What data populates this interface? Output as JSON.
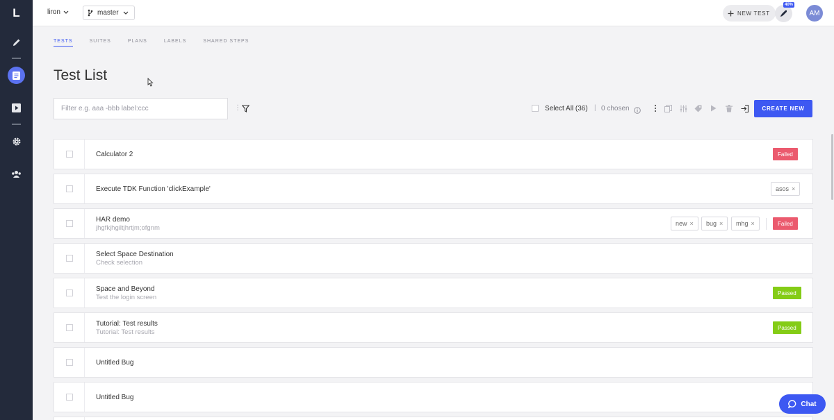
{
  "sidebar": {
    "logo": "L",
    "items": [
      {
        "name": "edit",
        "icon": "pencil-icon"
      },
      {
        "name": "tests",
        "icon": "list-icon",
        "active": true
      },
      {
        "name": "runs",
        "icon": "play-icon"
      },
      {
        "name": "settings",
        "icon": "gear-icon"
      },
      {
        "name": "team",
        "icon": "users-icon"
      }
    ]
  },
  "topbar": {
    "user": "liron",
    "branch": "master",
    "new_test": "NEW TEST",
    "notification_badge": "40%",
    "avatar": "AM"
  },
  "tabs": [
    {
      "label": "TESTS",
      "active": true
    },
    {
      "label": "SUITES",
      "active": false
    },
    {
      "label": "PLANS",
      "active": false
    },
    {
      "label": "LABELS",
      "active": false
    },
    {
      "label": "SHARED STEPS",
      "active": false
    }
  ],
  "page": {
    "title": "Test List"
  },
  "filter": {
    "placeholder": "Filter e.g. aaa -bbb label:ccc",
    "value": ""
  },
  "toolbar": {
    "select_all": "Select All (36)",
    "separator": "|",
    "chosen": "0 chosen",
    "create_new": "CREATE NEW"
  },
  "tests": [
    {
      "title": "Calculator 2",
      "subtitle": "",
      "labels": [],
      "status": "Failed"
    },
    {
      "title": "Execute TDK Function 'clickExample'",
      "subtitle": "",
      "labels": [
        "asos"
      ],
      "status": ""
    },
    {
      "title": "HAR demo",
      "subtitle": "jhgfkjhgiltjhrtjm;ofgnm",
      "labels": [
        "new",
        "bug",
        "mhg"
      ],
      "status": "Failed"
    },
    {
      "title": "Select Space Destination",
      "subtitle": "Check selection",
      "labels": [],
      "status": ""
    },
    {
      "title": "Space and Beyond",
      "subtitle": "Test the login screen",
      "labels": [],
      "status": "Passed"
    },
    {
      "title": "Tutorial: Test results",
      "subtitle": "Tutorial: Test results",
      "labels": [],
      "status": "Passed"
    },
    {
      "title": "Untitled Bug",
      "subtitle": "",
      "labels": [],
      "status": ""
    },
    {
      "title": "Untitled Bug",
      "subtitle": "",
      "labels": [],
      "status": ""
    }
  ],
  "label_remove_glyph": "×",
  "chat": {
    "label": "Chat"
  },
  "colors": {
    "accent": "#3d58f2",
    "sidebar": "#232a3b",
    "failed": "#eb5a6e",
    "passed": "#84cc16"
  }
}
